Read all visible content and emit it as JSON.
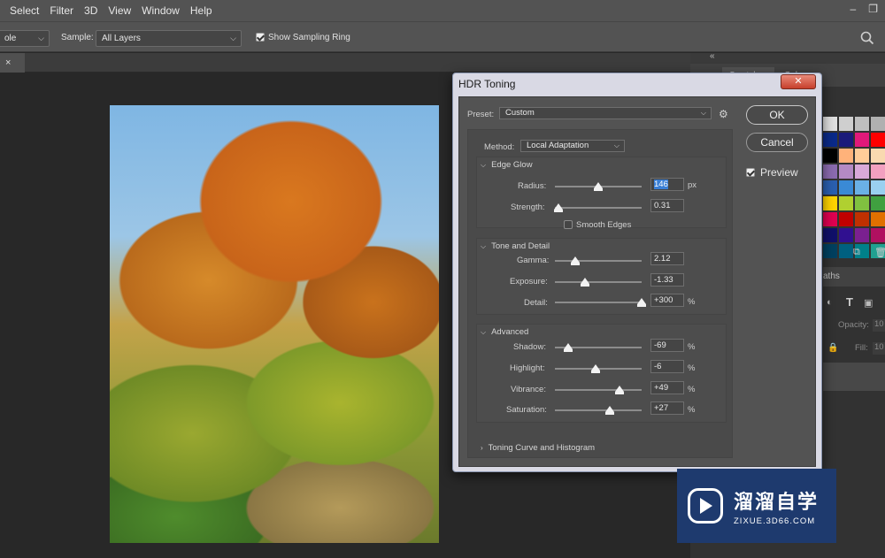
{
  "menubar": {
    "items": [
      "Select",
      "Filter",
      "3D",
      "View",
      "Window",
      "Help"
    ],
    "window_minimize": "–",
    "window_restore": "❐"
  },
  "options": {
    "mode_value": "ole",
    "sample_label": "Sample:",
    "sample_value": "All Layers",
    "show_sampling_ring_label": "Show Sampling Ring",
    "show_sampling_ring_checked": true
  },
  "document_tab": {
    "close": "×"
  },
  "dock": {
    "collapse": "«",
    "tab_swatches": "Swatches",
    "tab_color": "Color",
    "tab_paths": "aths",
    "opacity_label": "Opacity:",
    "opacity_value": "10",
    "fill_label": "Fill:",
    "fill_value": "10",
    "swatch_colors": [
      "#e0e0e0",
      "#cfcfcf",
      "#bfbfbf",
      "#b0b0b0",
      "#a0a0a0",
      "#0a2a8a",
      "#1a1a7a",
      "#e0197a",
      "#ff0000",
      "#a0a0a0",
      "#000000",
      "#ffb27a",
      "#ffcc99",
      "#f9d9b0",
      "#d9d9d9",
      "#8b6bb0",
      "#b48ac4",
      "#d9a9d9",
      "#f2a0c0",
      "#9cc4e6",
      "#2a5fb0",
      "#3a8ad6",
      "#6ab0e6",
      "#9ad0f0",
      "#c8e6f6",
      "#ffd400",
      "#b0d030",
      "#80c040",
      "#40a040",
      "#208040",
      "#e00050",
      "#c00000",
      "#c03000",
      "#e07000",
      "#f0a000",
      "#10106a",
      "#301090",
      "#7a2090",
      "#b01060",
      "#e01040",
      "#004060",
      "#006080",
      "#00808a",
      "#20a090",
      "#40b080"
    ]
  },
  "dialog": {
    "title": "HDR Toning",
    "close": "✕",
    "preset_label": "Preset:",
    "preset_value": "Custom",
    "ok": "OK",
    "cancel": "Cancel",
    "preview_label": "Preview",
    "preview_checked": true,
    "method_label": "Method:",
    "method_value": "Local Adaptation",
    "edge_glow": {
      "title": "Edge Glow",
      "radius": {
        "label": "Radius:",
        "value": "146",
        "unit": "px",
        "pos": 0.5
      },
      "strength": {
        "label": "Strength:",
        "value": "0.31",
        "pos": 0.04
      },
      "smooth_edges_label": "Smooth Edges",
      "smooth_edges_checked": false
    },
    "tone_detail": {
      "title": "Tone and Detail",
      "gamma": {
        "label": "Gamma:",
        "value": "2.12",
        "pos": 0.23
      },
      "exposure": {
        "label": "Exposure:",
        "value": "-1.33",
        "pos": 0.35
      },
      "detail": {
        "label": "Detail:",
        "value": "+300",
        "unit": "%",
        "pos": 1.0
      }
    },
    "advanced": {
      "title": "Advanced",
      "shadow": {
        "label": "Shadow:",
        "value": "-69",
        "unit": "%",
        "pos": 0.15
      },
      "highlight": {
        "label": "Highlight:",
        "value": "-6",
        "unit": "%",
        "pos": 0.47
      },
      "vibrance": {
        "label": "Vibrance:",
        "value": "+49",
        "unit": "%",
        "pos": 0.74
      },
      "saturation": {
        "label": "Saturation:",
        "value": "+27",
        "unit": "%",
        "pos": 0.63
      }
    },
    "toning_curve_label": "Toning Curve and Histogram"
  },
  "watermark": {
    "big": "溜溜自学",
    "small": "ZIXUE.3D66.COM"
  }
}
